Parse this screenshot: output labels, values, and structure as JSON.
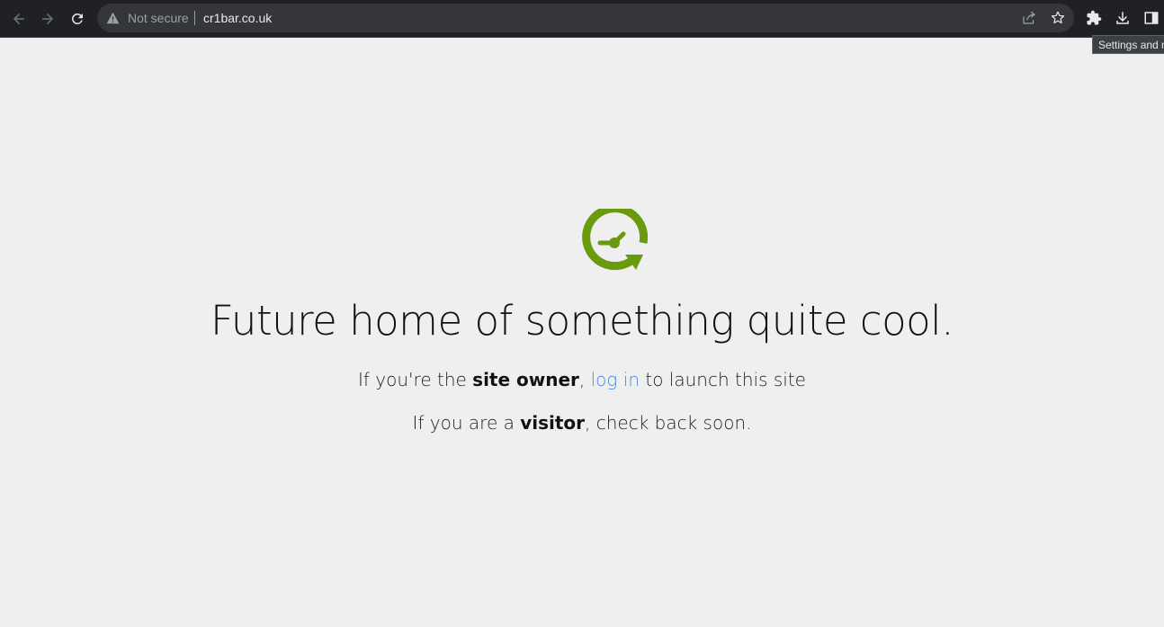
{
  "browser": {
    "security_label": "Not secure",
    "url": "cr1bar.co.uk",
    "tooltip": "Settings and more"
  },
  "page": {
    "headline": "Future home of something quite cool.",
    "owner_line": {
      "prefix": "If you're the ",
      "bold": "site owner",
      "comma": ", ",
      "link": "log in",
      "suffix": " to launch this site"
    },
    "visitor_line": {
      "prefix": "If you are a ",
      "bold": "visitor",
      "suffix": ", check back soon."
    },
    "logo_color": "#6a9a0e"
  },
  "icons": {
    "back": "back-arrow-icon",
    "forward": "forward-arrow-icon",
    "reload": "reload-icon",
    "warning": "warning-icon",
    "share": "share-icon",
    "bookmark": "star-icon",
    "extensions": "puzzle-icon",
    "downloads": "download-icon",
    "side_panel": "side-panel-icon",
    "logo": "clock-refresh-icon"
  }
}
